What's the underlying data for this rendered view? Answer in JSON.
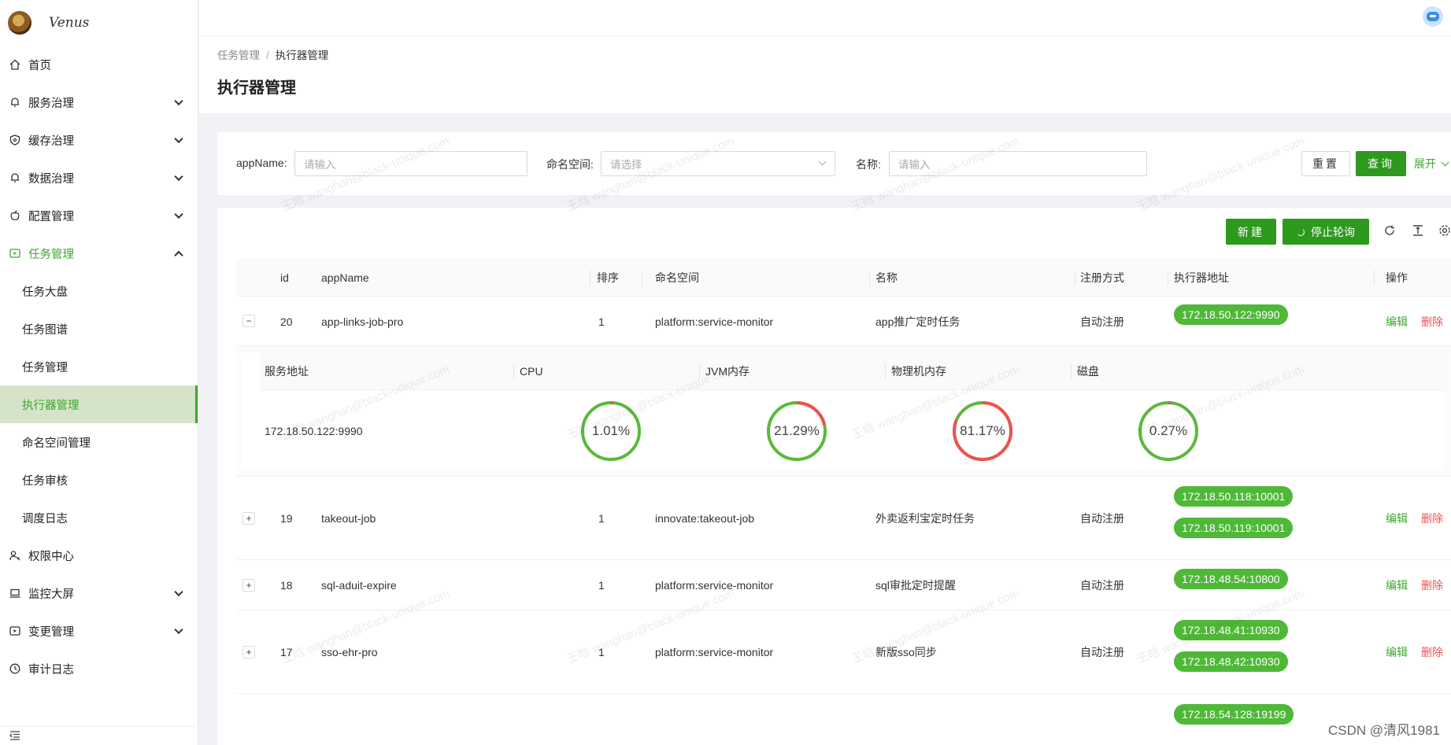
{
  "app": {
    "logo_text": "Venus"
  },
  "sidebar": {
    "items": [
      {
        "label": "首页",
        "icon": "home-icon"
      },
      {
        "label": "服务治理",
        "icon": "bell-icon"
      },
      {
        "label": "缓存治理",
        "icon": "shield-icon"
      },
      {
        "label": "数据治理",
        "icon": "bell-icon"
      },
      {
        "label": "配置管理",
        "icon": "apple-icon"
      },
      {
        "label": "任务管理",
        "icon": "play-square-icon"
      },
      {
        "label": "权限中心",
        "icon": "user-key-icon"
      },
      {
        "label": "监控大屏",
        "icon": "laptop-icon"
      },
      {
        "label": "变更管理",
        "icon": "play-square-icon"
      },
      {
        "label": "审计日志",
        "icon": "clock-icon"
      }
    ],
    "task_sub": [
      "任务大盘",
      "任务图谱",
      "任务管理",
      "执行器管理",
      "命名空间管理",
      "任务审核",
      "调度日志"
    ]
  },
  "breadcrumb": {
    "parent": "任务管理",
    "sep": "/",
    "current": "执行器管理"
  },
  "page": {
    "title": "执行器管理"
  },
  "filters": {
    "appname_label": "appName:",
    "appname_placeholder": "请输入",
    "namespace_label": "命名空间:",
    "namespace_placeholder": "请选择",
    "name_label": "名称:",
    "name_placeholder": "请输入",
    "reset": "重置",
    "query": "查询",
    "expand": "展开"
  },
  "toolbar": {
    "new": "新建",
    "stop_poll": "停止轮询"
  },
  "table": {
    "columns": [
      "id",
      "appName",
      "排序",
      "命名空间",
      "名称",
      "注册方式",
      "执行器地址",
      "操作"
    ],
    "rows": [
      {
        "expand": "−",
        "id": "20",
        "appName": "app-links-job-pro",
        "sort": "1",
        "namespace": "platform:service-monitor",
        "name": "app推广定时任务",
        "reg": "自动注册",
        "addrs": [
          "172.18.50.122:9990"
        ],
        "edit": "编辑",
        "del": "删除"
      },
      {
        "expand": "+",
        "id": "19",
        "appName": "takeout-job",
        "sort": "1",
        "namespace": "innovate:takeout-job",
        "name": "外卖返利宝定时任务",
        "reg": "自动注册",
        "addrs": [
          "172.18.50.118:10001",
          "172.18.50.119:10001"
        ],
        "edit": "编辑",
        "del": "删除"
      },
      {
        "expand": "+",
        "id": "18",
        "appName": "sql-aduit-expire",
        "sort": "1",
        "namespace": "platform:service-monitor",
        "name": "sql审批定时提醒",
        "reg": "自动注册",
        "addrs": [
          "172.18.48.54:10800"
        ],
        "edit": "编辑",
        "del": "删除"
      },
      {
        "expand": "+",
        "id": "17",
        "appName": "sso-ehr-pro",
        "sort": "1",
        "namespace": "platform:service-monitor",
        "name": "新版sso同步",
        "reg": "自动注册",
        "addrs": [
          "172.18.48.41:10930",
          "172.18.48.42:10930"
        ],
        "edit": "编辑",
        "del": "删除"
      },
      {
        "addrs": [
          "172.18.54.128:19199"
        ]
      }
    ]
  },
  "detail": {
    "columns": [
      "服务地址",
      "CPU",
      "JVM内存",
      "物理机内存",
      "磁盘"
    ],
    "address": "172.18.50.122:9990",
    "metrics": [
      {
        "label": "1.01%",
        "value": 1.01,
        "color": "#f0504f",
        "track": "#5cb83c"
      },
      {
        "label": "21.29%",
        "value": 21.29,
        "color": "#f0504f",
        "track": "#5cb83c"
      },
      {
        "label": "81.17%",
        "value": 81.17,
        "color": "#f0504f",
        "track": "#5cb83c"
      },
      {
        "label": "0.27%",
        "value": 0.27,
        "color": "#f0504f",
        "track": "#5cb83c"
      }
    ]
  },
  "watermark": "王晗 wanghan@black-unique.com",
  "footer_mark": "CSDN @清风1981"
}
